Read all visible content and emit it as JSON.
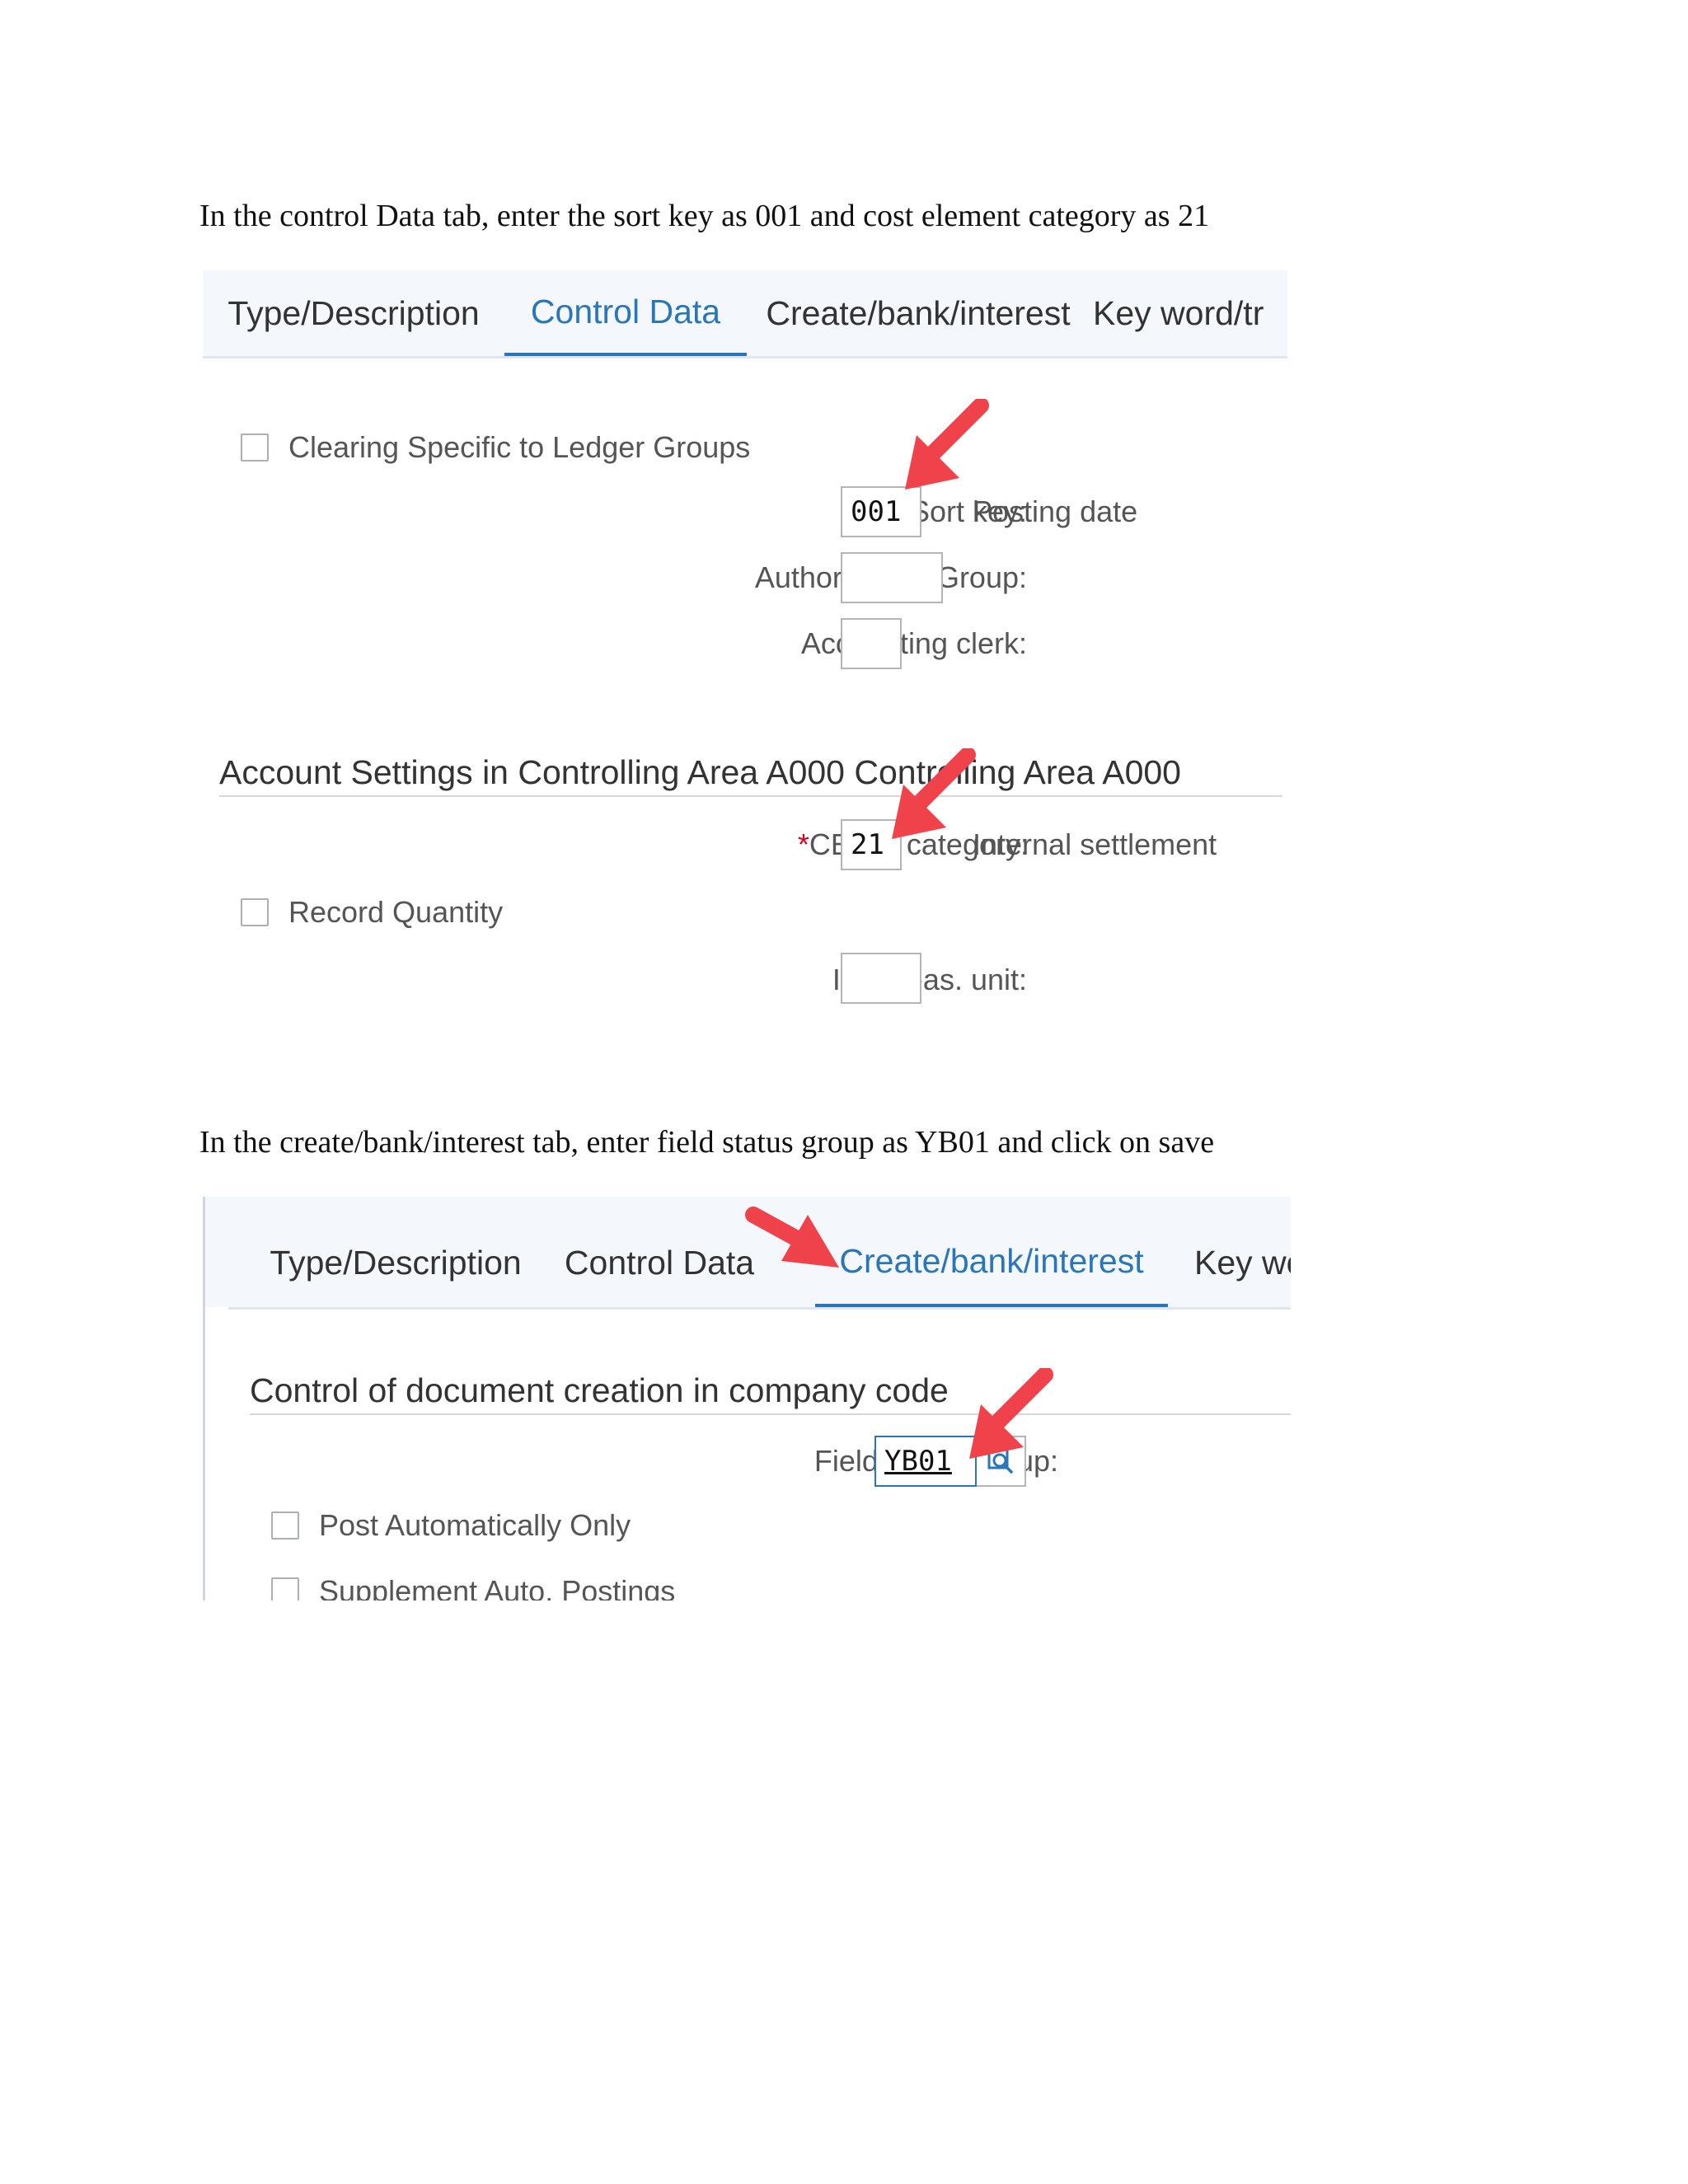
{
  "instruction1": "In the control Data tab, enter the sort key as 001 and cost element category as 21",
  "instruction2": "In the create/bank/interest tab, enter field status group as YB01 and click on save",
  "screen1": {
    "tabs": [
      "Type/Description",
      "Control Data",
      "Create/bank/interest",
      "Key word/tr"
    ],
    "active_tab": "Control Data",
    "clearing_checkbox_label": "Clearing Specific to Ledger Groups",
    "sort_key_label": "Sort key:",
    "sort_key_value": "001",
    "sort_key_desc": "Posting date",
    "auth_group_label": "Authorization Group:",
    "auth_group_value": "",
    "acct_clerk_label": "Accounting clerk:",
    "acct_clerk_value": "",
    "section_title": "Account Settings in Controlling Area A000 Controlling Area A000",
    "required_marker": "*",
    "celem_label": "CElem category:",
    "celem_value": "21",
    "celem_desc": "Internal settlement",
    "record_qty_label": "Record Quantity",
    "int_meas_label": "Int. meas. unit:",
    "int_meas_value": ""
  },
  "screen2": {
    "tabs": [
      "Type/Description",
      "Control Data",
      "Create/bank/interest",
      "Key wo"
    ],
    "active_tab": "Create/bank/interest",
    "section_title": "Control of document creation in company code",
    "field_status_label": "Field status group:",
    "field_status_value": "YB01",
    "post_auto_label": "Post Automatically Only",
    "supp_auto_label": "Supplement Auto. Postings"
  },
  "colors": {
    "accent": "#2a76b8",
    "arrow": "#f0424a",
    "required": "#d0021b"
  },
  "icons": [
    "red-arrow-icon",
    "value-help-icon"
  ]
}
